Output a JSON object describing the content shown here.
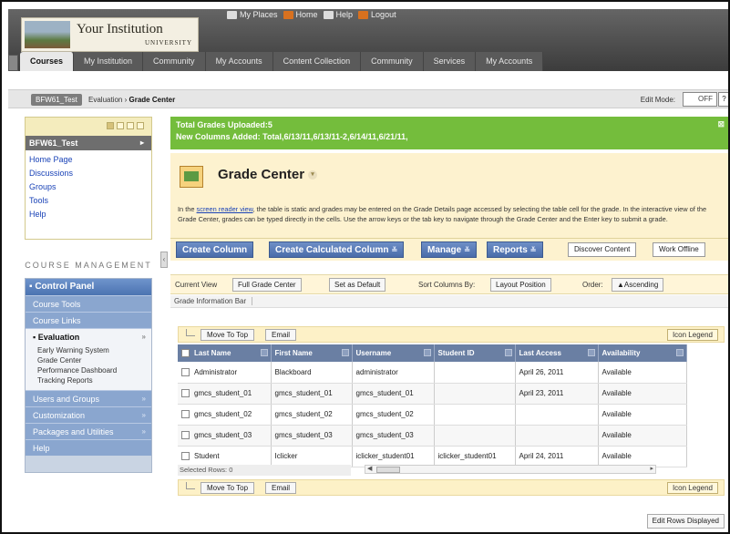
{
  "header": {
    "institution_name": "Your Institution",
    "institution_sub": "UNIVERSITY",
    "top_links": [
      {
        "label": "My Places",
        "icon": "places-icon"
      },
      {
        "label": "Home",
        "icon": "home-icon"
      },
      {
        "label": "Help",
        "icon": "help-icon"
      },
      {
        "label": "Logout",
        "icon": "logout-icon"
      }
    ],
    "tabs": [
      "Courses",
      "My Institution",
      "Community",
      "My Accounts",
      "Content Collection",
      "Community",
      "Services",
      "My Accounts"
    ],
    "active_tab": "Courses"
  },
  "breadcrumb": {
    "course": "BFW61_Test",
    "section": "Evaluation",
    "separator": "›",
    "current": "Grade Center"
  },
  "edit_mode": {
    "label": "Edit Mode:",
    "value": "OFF",
    "help": "?"
  },
  "course_menu": {
    "title": "BFW61_Test",
    "links": [
      "Home Page",
      "Discussions",
      "Groups",
      "Tools",
      "Help"
    ]
  },
  "course_management": {
    "label": "COURSE MANAGEMENT",
    "control_panel": "Control Panel",
    "items_top": [
      "Course Tools",
      "Course Links"
    ],
    "evaluation": "Evaluation",
    "evaluation_sub": [
      "Early Warning System",
      "Grade Center",
      "Performance Dashboard",
      "Tracking Reports"
    ],
    "items_bottom": [
      "Users and Groups",
      "Customization",
      "Packages and Utilities",
      "Help"
    ]
  },
  "receipt": {
    "line1": "Total Grades Uploaded:5",
    "line2": "New Columns Added: Total,6/13/11,6/13/11-2,6/14/11,6/21/11,",
    "close": "⊠"
  },
  "grade_center": {
    "title": "Grade Center",
    "desc_pre": "In the ",
    "desc_link": "screen reader view",
    "desc_post": ", the table is static and grades may be entered on the Grade Details page accessed by selecting the table cell for the grade. In the interactive view of the Grade Center, grades can be typed directly in the cells. Use the arrow keys or the tab key to navigate through the Grade Center and the Enter key to submit a grade."
  },
  "action_bar": {
    "create_column": "Create Column",
    "create_calculated": "Create Calculated Column",
    "manage": "Manage",
    "reports": "Reports",
    "caret": "≚",
    "discover": "Discover Content",
    "offline": "Work Offline"
  },
  "view_bar": {
    "current_view_label": "Current View",
    "current_view": "Full Grade Center",
    "set_default": "Set as Default",
    "sort_label": "Sort Columns By:",
    "sort_value": "Layout Position",
    "order_label": "Order:",
    "order_value": "▲Ascending"
  },
  "info_bar": "Grade Information Bar",
  "table_tools": {
    "move_to_top": "Move To Top",
    "email": "Email",
    "icon_legend": "Icon Legend"
  },
  "table": {
    "columns": [
      "Last Name",
      "First Name",
      "Username",
      "Student ID",
      "Last Access",
      "Availability"
    ],
    "rows": [
      [
        "Administrator",
        "Blackboard",
        "administrator",
        "",
        "April 26, 2011",
        "Available"
      ],
      [
        "gmcs_student_01",
        "gmcs_student_01",
        "gmcs_student_01",
        "",
        "April 23, 2011",
        "Available"
      ],
      [
        "gmcs_student_02",
        "gmcs_student_02",
        "gmcs_student_02",
        "",
        "",
        "Available"
      ],
      [
        "gmcs_student_03",
        "gmcs_student_03",
        "gmcs_student_03",
        "",
        "",
        "Available"
      ],
      [
        "Student",
        "Iclicker",
        "iclicker_student01",
        "iclicker_student01",
        "April 24, 2011",
        "Available"
      ]
    ],
    "selected_rows": "Selected Rows: 0"
  },
  "edit_rows": "Edit Rows Displayed"
}
